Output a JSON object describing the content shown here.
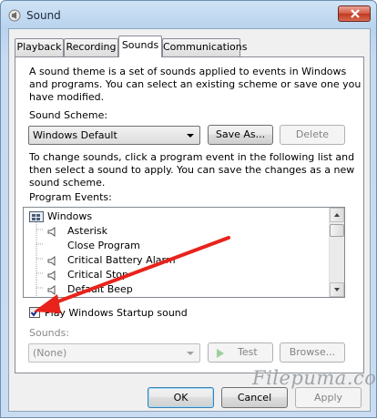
{
  "window": {
    "title": "Sound"
  },
  "tabs": [
    {
      "label": "Playback"
    },
    {
      "label": "Recording"
    },
    {
      "label": "Sounds",
      "active": true
    },
    {
      "label": "Communications"
    }
  ],
  "sounds_tab": {
    "intro": [
      "A sound theme is a set of sounds applied to events in Windows",
      "and programs.  You can select an existing scheme or save one you",
      "have modified."
    ],
    "scheme_label": "Sound Scheme:",
    "scheme_value": "Windows Default",
    "save_as_label": "Save As...",
    "delete_label": "Delete",
    "instructions": [
      "To change sounds, click a program event in the following list and",
      "then select a sound to apply.  You can save the changes as a new",
      "sound scheme."
    ],
    "program_events_label": "Program Events:",
    "events": [
      {
        "label": "Windows",
        "icon": "windows-flag-icon",
        "group": true
      },
      {
        "label": "Asterisk",
        "icon": "speaker-icon"
      },
      {
        "label": "Close Program",
        "icon": ""
      },
      {
        "label": "Critical Battery Alarm",
        "icon": "speaker-icon"
      },
      {
        "label": "Critical Stop",
        "icon": "speaker-icon"
      },
      {
        "label": "Default Beep",
        "icon": "speaker-icon"
      }
    ],
    "startup_sound_label": "Play Windows Startup sound",
    "startup_sound_checked": true,
    "sounds_label": "Sounds:",
    "sounds_value": "(None)",
    "test_label": "Test",
    "browse_label": "Browse..."
  },
  "footer": {
    "ok_label": "OK",
    "cancel_label": "Cancel",
    "apply_label": "Apply"
  },
  "watermark": "Filepuma.com",
  "colors": {
    "annotation_arrow": "#e8231b",
    "title_bar": "#c6daf0",
    "close_button": "#c9452d"
  }
}
